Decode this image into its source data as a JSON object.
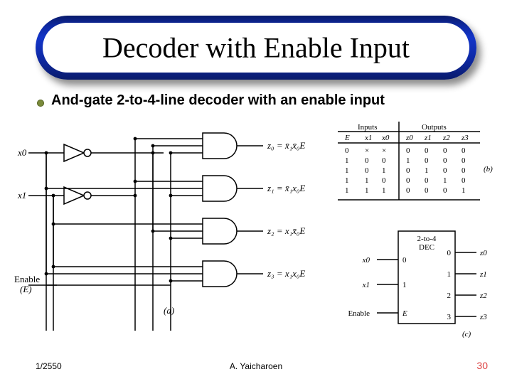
{
  "title": "Decoder with Enable Input",
  "subtitle": "And-gate 2-to-4-line decoder with an enable input",
  "footer": {
    "left": "1/2550",
    "mid": "A. Yaicharoen",
    "right": "30"
  },
  "circuit": {
    "inputs": [
      "x0",
      "x1"
    ],
    "enable_label": "Enable",
    "enable_symbol": "(E)",
    "outputs": [
      {
        "name": "z0",
        "expr": "z₀ = x̄₁x̄₀E"
      },
      {
        "name": "z1",
        "expr": "z₁ = x̄₁x₀E"
      },
      {
        "name": "z2",
        "expr": "z₂ = x₁x̄₀E"
      },
      {
        "name": "z3",
        "expr": "z₃ = x₁x₀E"
      }
    ],
    "part_label_a": "(a)"
  },
  "truth_table": {
    "header_inputs": "Inputs",
    "header_outputs": "Outputs",
    "cols_in": [
      "E",
      "x1",
      "x0"
    ],
    "cols_out": [
      "z0",
      "z1",
      "z2",
      "z3"
    ],
    "rows": [
      [
        "0",
        "×",
        "×",
        "0",
        "0",
        "0",
        "0"
      ],
      [
        "1",
        "0",
        "0",
        "1",
        "0",
        "0",
        "0"
      ],
      [
        "1",
        "0",
        "1",
        "0",
        "1",
        "0",
        "0"
      ],
      [
        "1",
        "1",
        "0",
        "0",
        "0",
        "1",
        "0"
      ],
      [
        "1",
        "1",
        "1",
        "0",
        "0",
        "0",
        "1"
      ]
    ],
    "part_label_b": "(b)"
  },
  "block": {
    "title": "2-to-4\nDEC",
    "left_ports": [
      {
        "ext": "x0",
        "int": "0"
      },
      {
        "ext": "x1",
        "int": "1"
      },
      {
        "ext": "Enable",
        "int": "E"
      }
    ],
    "right_ports": [
      {
        "int": "0",
        "ext": "z0"
      },
      {
        "int": "1",
        "ext": "z1"
      },
      {
        "int": "2",
        "ext": "z2"
      },
      {
        "int": "3",
        "ext": "z3"
      }
    ],
    "part_label_c": "(c)"
  }
}
